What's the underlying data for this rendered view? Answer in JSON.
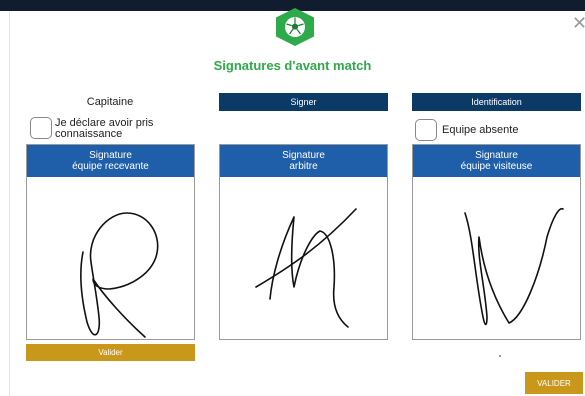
{
  "header": {
    "title": "Signatures d'avant match",
    "close_glyph": "✕",
    "badge_icon": "soccer-ball-icon",
    "accent_color": "#2eaa4a"
  },
  "left_column": {
    "label": "Capitaine",
    "checkbox_label_line1": "Je déclare avoir pris",
    "checkbox_label_line2": "connaissance",
    "checkbox_checked": false,
    "panel_title_line1": "Signature",
    "panel_title_line2": "équipe recevante",
    "button_label": "Valider"
  },
  "middle_column": {
    "button_label": "Signer",
    "panel_title_line1": "Signature",
    "panel_title_line2": "arbitre"
  },
  "right_column": {
    "button_label": "Identification",
    "checkbox_label": "Equipe absente",
    "checkbox_checked": false,
    "panel_title_line1": "Signature",
    "panel_title_line2": "équipe visiteuse"
  },
  "footer": {
    "validate_label": "VALIDER"
  },
  "colors": {
    "panel_header": "#1f5ea8",
    "dark_button": "#0b3a66",
    "gold_button": "#c9971a"
  }
}
